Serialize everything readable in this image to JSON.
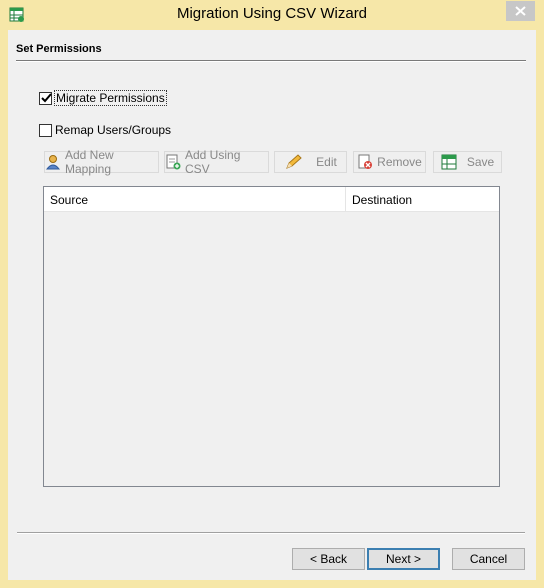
{
  "window": {
    "title": "Migration Using CSV Wizard",
    "close_glyph": "✕"
  },
  "section": {
    "title": "Set Permissions"
  },
  "options": {
    "migrate_permissions": {
      "label": "Migrate Permissions",
      "checked": true
    },
    "remap_users": {
      "label": "Remap Users/Groups",
      "checked": false
    }
  },
  "toolbar": {
    "add_new_mapping": "Add New Mapping",
    "add_using_csv": "Add Using CSV",
    "edit": "Edit",
    "remove": "Remove",
    "save": "Save"
  },
  "table": {
    "columns": [
      "Source",
      "Destination"
    ],
    "rows": []
  },
  "footer": {
    "back": "< Back",
    "next": "Next >",
    "cancel": "Cancel"
  },
  "colors": {
    "frame": "#f6e7a8",
    "close_button": "#c7c7c7",
    "default_button_border": "#3c7fb1"
  }
}
